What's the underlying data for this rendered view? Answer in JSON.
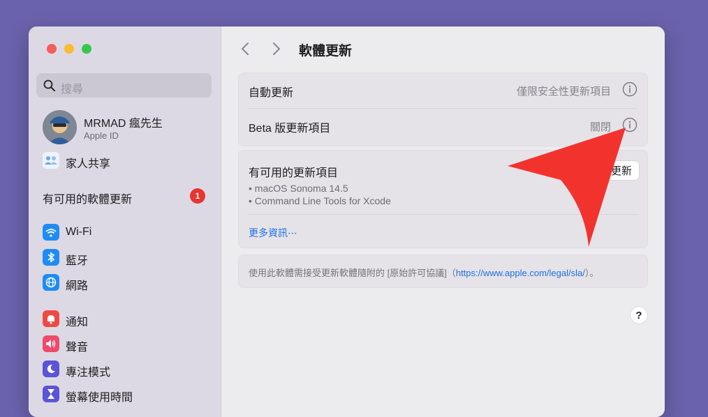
{
  "sidebar": {
    "search_placeholder": "搜尋",
    "profile": {
      "name": "MRMAD 瘋先生",
      "subtitle": "Apple ID"
    },
    "family_sharing": "家人共享",
    "updates_available": {
      "label": "有可用的軟體更新",
      "count": "1"
    },
    "network_items": [
      "Wi-Fi",
      "藍牙",
      "網路"
    ],
    "system_items": [
      "通知",
      "聲音",
      "專注模式",
      "螢幕使用時間"
    ]
  },
  "header": {
    "title": "軟體更新"
  },
  "settings": {
    "auto_update": {
      "label": "自動更新",
      "value": "僅限安全性更新項目"
    },
    "beta_updates": {
      "label": "Beta 版更新項目",
      "value": "關閉"
    }
  },
  "updates": {
    "title": "有可用的更新項目",
    "button_label": "更新",
    "items": [
      "• macOS Sonoma 14.5",
      "• Command Line Tools for Xcode"
    ],
    "more_info": "更多資訊⋯"
  },
  "license": {
    "prefix": "使用此軟體需接受更新軟體隨附的 [原始許可協議]（",
    "link": "https://www.apple.com/legal/sla/",
    "suffix": "）。"
  },
  "help": {
    "label": "?"
  },
  "colors": {
    "background": "#6a62ac",
    "accent": "#1e6fe0",
    "badge": "#e8352e",
    "arrow": "#f2332d"
  },
  "icons": {
    "family": "family-icon",
    "wifi": "wifi-icon",
    "bluetooth": "bluetooth-icon",
    "network": "globe-icon",
    "notifications": "bell-icon",
    "sound": "speaker-icon",
    "focus": "moon-icon",
    "screen_time": "hourglass-icon",
    "info": "info-icon"
  }
}
